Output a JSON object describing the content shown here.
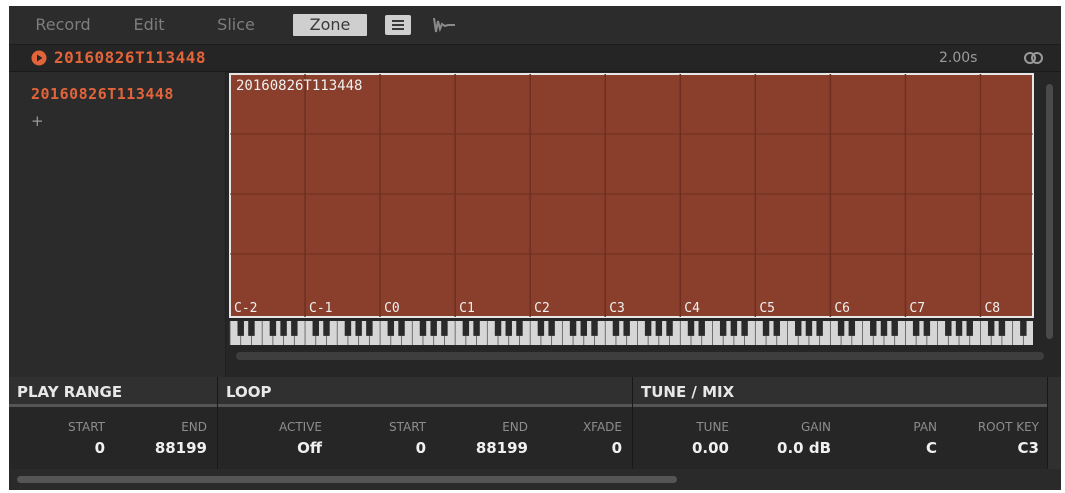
{
  "tabs": [
    {
      "label": "Record",
      "active": false
    },
    {
      "label": "Edit",
      "active": false
    },
    {
      "label": "Slice",
      "active": false
    },
    {
      "label": "Zone",
      "active": true
    }
  ],
  "toolbar_icons": [
    "menu-icon",
    "waveform-icon"
  ],
  "header": {
    "sample_name": "20160826T113448",
    "duration": "2.00s",
    "icons": [
      "play-icon",
      "link-icon"
    ]
  },
  "sample_list": {
    "items": [
      "20160826T113448"
    ],
    "add_label": "+"
  },
  "zone_map": {
    "zone_label": "20160826T113448",
    "octave_labels": [
      "C-2",
      "C-1",
      "C0",
      "C1",
      "C2",
      "C3",
      "C4",
      "C5",
      "C6",
      "C7",
      "C8"
    ],
    "zone_color": "#8a3f2d",
    "accent_color": "#e2643a"
  },
  "params": {
    "play_range": {
      "title": "PLAY RANGE",
      "labels": [
        "START",
        "END"
      ],
      "values": [
        "0",
        "88199"
      ]
    },
    "loop": {
      "title": "LOOP",
      "labels": [
        "ACTIVE",
        "START",
        "END",
        "XFADE"
      ],
      "values": [
        "Off",
        "0",
        "88199",
        "0"
      ]
    },
    "tune_mix": {
      "title": "TUNE / MIX",
      "labels": [
        "TUNE",
        "GAIN",
        "PAN",
        "ROOT KEY"
      ],
      "values": [
        "0.00",
        "0.0 dB",
        "C",
        "C3"
      ]
    }
  }
}
